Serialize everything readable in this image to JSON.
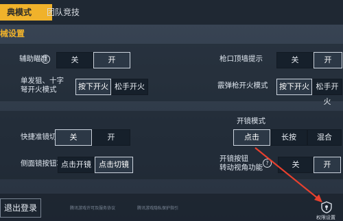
{
  "tabs": {
    "active": "典模式",
    "team": "团队竞技"
  },
  "section": {
    "title": "械设置"
  },
  "settings": {
    "assist_aim": {
      "label": "辅助瞄准",
      "opts": [
        "关",
        "开"
      ]
    },
    "muzzle_tip": {
      "label": "枪口顶墙提示",
      "opts": [
        "关",
        "开"
      ]
    },
    "sniper_fire": {
      "label1": "单发狙、十字",
      "label2": "弩开火模式",
      "opts": [
        "按下开火",
        "松手开火"
      ]
    },
    "shotgun_fire": {
      "label": "霰弹枪开火模式",
      "opts": [
        "按下开火",
        "松手开火"
      ]
    },
    "scope_mode": {
      "label": "开镜模式",
      "opts": [
        "点击",
        "长按",
        "混合"
      ]
    },
    "quick_scope": {
      "label": "快捷准镜切换",
      "opts": [
        "关",
        "开"
      ]
    },
    "side_scope": {
      "label": "侧面镜按钮功能",
      "opts": [
        "点击开镜",
        "点击切镜"
      ]
    },
    "scope_btn_view": {
      "label1": "开镜按钮",
      "label2": "转动视角功能",
      "opts": [
        "关",
        "开"
      ]
    }
  },
  "help_glyph": "?",
  "bottom": {
    "logout": "退出登录",
    "link1": "腾讯游戏许可及服务协议",
    "link2": "腾讯游戏隐私保护指引",
    "privacy": "权限设置"
  },
  "colors": {
    "accent": "#f0b22b",
    "arrow": "#e8402e"
  }
}
